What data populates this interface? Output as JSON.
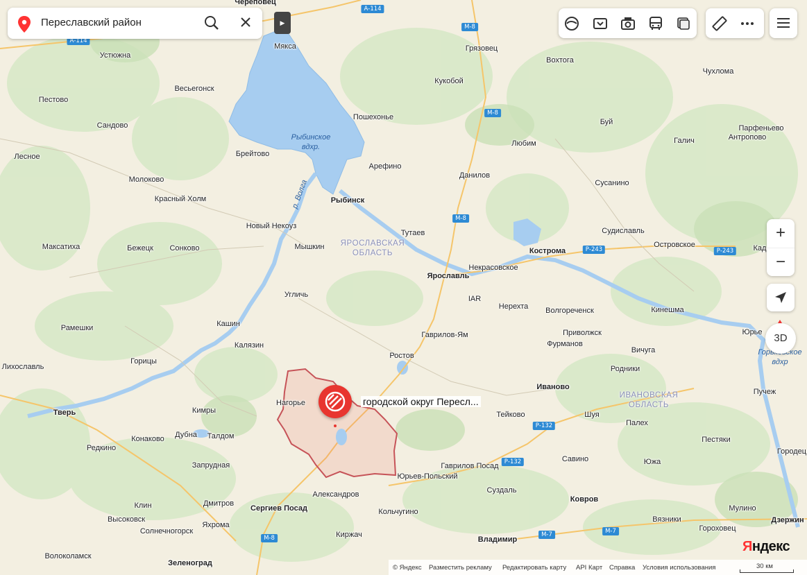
{
  "search": {
    "value": "Переславский район"
  },
  "marker_label": "городской округ Пересл...",
  "button_3d": "3D",
  "zoom": {
    "in": "+",
    "out": "−"
  },
  "logo": {
    "first": "Я",
    "rest": "ндекс"
  },
  "scale_label": "30 км",
  "footer": {
    "copyright": "© Яндекс",
    "ads": "Разместить рекламу",
    "edit": "Редактировать карту",
    "api": "API Карт",
    "help": "Справка",
    "terms": "Условия использования"
  },
  "regions": [
    "ЯРОСЛАВСКАЯ",
    "ОБЛАСТЬ",
    "ИВАНОВСКАЯ",
    "ОБЛАСТЬ"
  ],
  "water": [
    "Рыбинское",
    "вдхр.",
    "Горьковское",
    "вдхр",
    "р. Волга"
  ],
  "cities_bold": [
    "Череповец",
    "Рыбинск",
    "Ярославль",
    "Кострома",
    "Иваново",
    "Тверь",
    "Сергиев Посад",
    "Владимир",
    "Зеленоград",
    "Ковров",
    "Дзержин"
  ],
  "cities": [
    "Мякса",
    "Устюжна",
    "Весьегонск",
    "Пестово",
    "Сандово",
    "Лесное",
    "Брейтово",
    "Молоково",
    "Красный Холм",
    "Новый Некоуз",
    "Максатиха",
    "Бежецк",
    "Сонково",
    "Мышкин",
    "Пошехонье",
    "Кукобой",
    "Грязовец",
    "Вохтога",
    "Чухлома",
    "Буй",
    "Любим",
    "Галич",
    "Парфеньево",
    "Антропово",
    "Арефино",
    "Данилов",
    "Сусанино",
    "Тутаев",
    "Судиславль",
    "Островское",
    "Кад",
    "Некрасовское",
    "IAR",
    "Нерехта",
    "Волгореченск",
    "Кинешма",
    "Угличь",
    "Кашин",
    "Калязин",
    "Рамешки",
    "Гаврилов-Ям",
    "Приволжск",
    "Фурманов",
    "Юрье",
    "Лихославль",
    "Горицы",
    "Ростов",
    "Вичуга",
    "Родники",
    "Пучеж",
    "Нагорье",
    "Кимры",
    "Тейково",
    "Шуя",
    "Палех",
    "Конаково",
    "Дубна",
    "Талдом",
    "Редкино",
    "Пестяки",
    "Городец",
    "Запрудная",
    "Гаврилов Посад",
    "Савино",
    "Южа",
    "Юрьев-Польский",
    "Клин",
    "Дмитров",
    "Александров",
    "Суздаль",
    "Мулино",
    "Высоковск",
    "Кольчугино",
    "Вязники",
    "Солнечногорск",
    "Яхрома",
    "Киржач",
    "Гороховец",
    "Волоколамск"
  ],
  "roads": [
    "А-114",
    "А-114",
    "M-8",
    "M-8",
    "M-8",
    "M-8",
    "Р-243",
    "Р-243",
    "Р-132",
    "Р-132",
    "M-7",
    "M-7",
    "M-8"
  ]
}
